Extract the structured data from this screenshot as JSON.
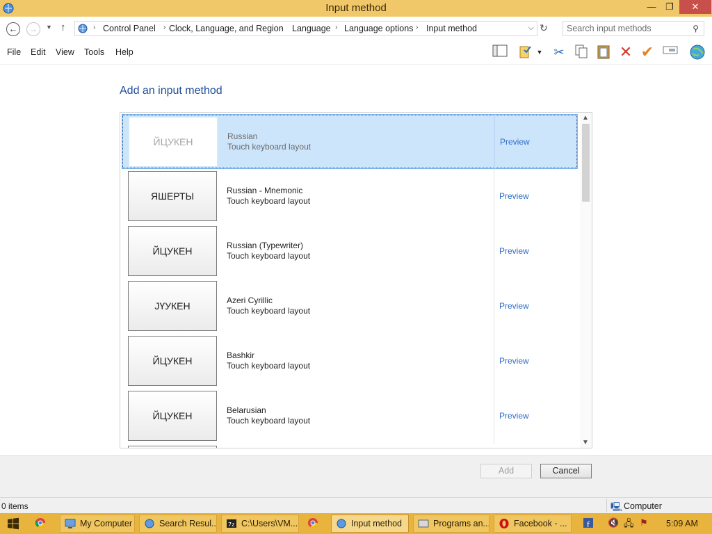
{
  "window": {
    "title": "Input method",
    "minimize_glyph": "—",
    "maximize_glyph": "❐",
    "close_glyph": "✕"
  },
  "address": {
    "breadcrumbs": [
      "Control Panel",
      "Clock, Language, and Region",
      "Language",
      "Language options",
      "Input method"
    ],
    "search_placeholder": "Search input methods"
  },
  "menu": {
    "items": [
      "File",
      "Edit",
      "View",
      "Tools",
      "Help"
    ]
  },
  "toolbar_icons": [
    "layout-pane-icon",
    "properties-icon",
    "cut-icon",
    "copy-icon",
    "paste-icon",
    "delete-icon",
    "checkmark-icon",
    "rename-icon",
    "globe-icon"
  ],
  "content": {
    "heading": "Add an input method",
    "rows": [
      {
        "thumb": "ЙЦУКЕН",
        "name": "Russian",
        "sub": "Touch keyboard layout",
        "link": "Preview",
        "selected": true
      },
      {
        "thumb": "ЯШЕРТЫ",
        "name": "Russian - Mnemonic",
        "sub": "Touch keyboard layout",
        "link": "Preview",
        "selected": false
      },
      {
        "thumb": "ЙЦУКЕН",
        "name": "Russian (Typewriter)",
        "sub": "Touch keyboard layout",
        "link": "Preview",
        "selected": false
      },
      {
        "thumb": "JҮУКЕН",
        "name": "Azeri Cyrillic",
        "sub": "Touch keyboard layout",
        "link": "Preview",
        "selected": false
      },
      {
        "thumb": "ЙЦУКЕН",
        "name": "Bashkir",
        "sub": "Touch keyboard layout",
        "link": "Preview",
        "selected": false
      },
      {
        "thumb": "ЙЦУКЕН",
        "name": "Belarusian",
        "sub": "Touch keyboard layout",
        "link": "Preview",
        "selected": false
      }
    ]
  },
  "buttons": {
    "add": "Add",
    "cancel": "Cancel"
  },
  "status": {
    "items": "0 items",
    "location": "Computer"
  },
  "taskbar": {
    "items": [
      "My Computer",
      "Search Resul...",
      "C:\\Users\\VM...",
      "Input method",
      "Programs an...",
      "Facebook - ..."
    ],
    "clock": "5:09 AM"
  },
  "colors": {
    "titlebar": "#f0c86a",
    "taskbar": "#e9b43e",
    "heading": "#1f4e99",
    "link": "#2e6dc8",
    "selection": "#cde5fb"
  }
}
